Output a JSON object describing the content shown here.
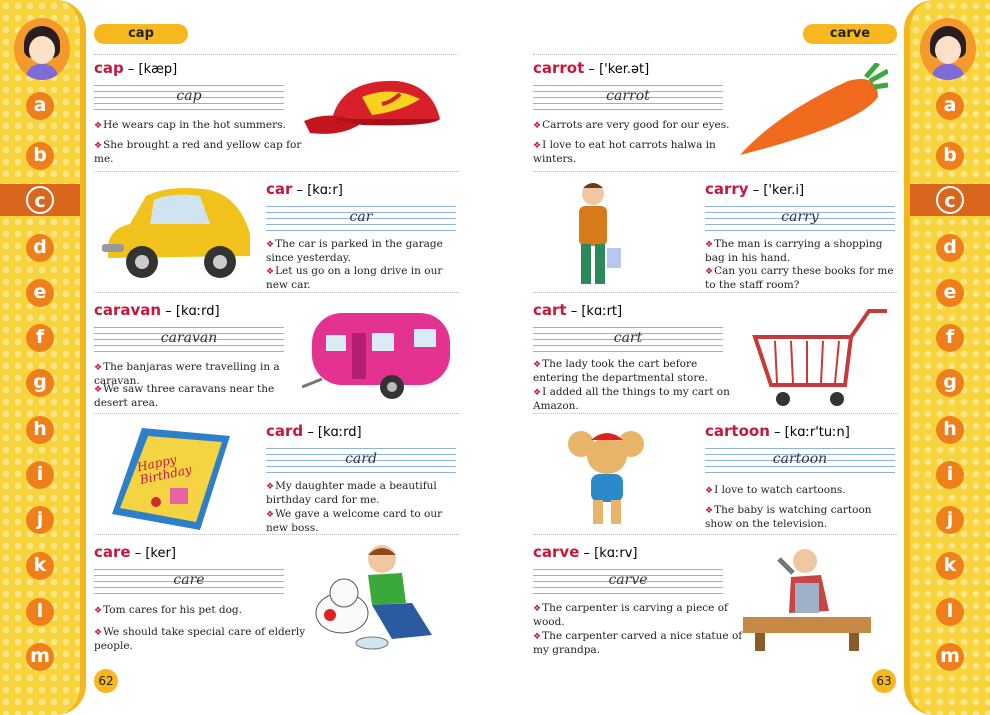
{
  "left_page": {
    "guide_word": "cap",
    "page_number": "62",
    "entries": [
      {
        "word": "cap",
        "pron": "[kæp]",
        "cursive": "cap",
        "s1": "He wears cap in the hot summers.",
        "s2": "She brought a red and yellow cap for me.",
        "icon": "cap-icon"
      },
      {
        "word": "car",
        "pron": "[kɑːr]",
        "cursive": "car",
        "s1": "The car is parked in the garage since yesterday.",
        "s2": "Let us go on a long drive in our new car.",
        "icon": "car-icon"
      },
      {
        "word": "caravan",
        "pron": "[kɑːrd]",
        "cursive": "caravan",
        "s1": "The banjaras were travelling in a caravan.",
        "s2": "We saw three caravans near the desert area.",
        "icon": "caravan-icon"
      },
      {
        "word": "card",
        "pron": "[kɑːrd]",
        "cursive": "card",
        "s1": "My daughter made a beautiful birthday card for me.",
        "s2": "We gave a welcome card to our new boss.",
        "icon": "birthday-card-icon"
      },
      {
        "word": "care",
        "pron": "[ker]",
        "cursive": "care",
        "s1": "Tom cares for his pet dog.",
        "s2": "We should take special care of elderly people.",
        "icon": "boy-with-dog-icon"
      }
    ]
  },
  "right_page": {
    "guide_word": "carve",
    "page_number": "63",
    "entries": [
      {
        "word": "carrot",
        "pron": "['ker.ət]",
        "cursive": "carrot",
        "s1": "Carrots are very good for our eyes.",
        "s2": "I love to eat hot carrots halwa in winters.",
        "icon": "carrot-icon"
      },
      {
        "word": "carry",
        "pron": "['ker.i]",
        "cursive": "carry",
        "s1": "The man is carrying a shopping bag in his hand.",
        "s2": "Can you carry these books for me to the staff room?",
        "icon": "man-with-bag-icon"
      },
      {
        "word": "cart",
        "pron": "[kɑːrt]",
        "cursive": "cart",
        "s1": "The lady took the cart before entering the departmental store.",
        "s2": "I added all the things to my cart on Amazon.",
        "icon": "shopping-cart-icon"
      },
      {
        "word": "cartoon",
        "pron": "[kɑːr'tuːn]",
        "cursive": "cartoon",
        "s1": "I love to watch cartoons.",
        "s2": "The baby is watching cartoon show on the television.",
        "icon": "cartoon-mouse-icon"
      },
      {
        "word": "carve",
        "pron": "[kɑːrv]",
        "cursive": "carve",
        "s1": "The carpenter is carving a piece of wood.",
        "s2": "The carpenter carved a nice statue of my grandpa.",
        "icon": "carpenter-icon"
      }
    ]
  },
  "alphabet": [
    "a",
    "b",
    "c",
    "d",
    "e",
    "f",
    "g",
    "h",
    "i",
    "j",
    "k",
    "l",
    "m"
  ],
  "active_letter": "c",
  "card_text": "Happy Birthday",
  "colors": {
    "headword": "#c4183f",
    "tab": "#f6b81e",
    "side": "#f7d33c",
    "letter": "#ef7f1a",
    "letter_active": "#d9661d",
    "guide_lines": "#8fb1e6"
  }
}
